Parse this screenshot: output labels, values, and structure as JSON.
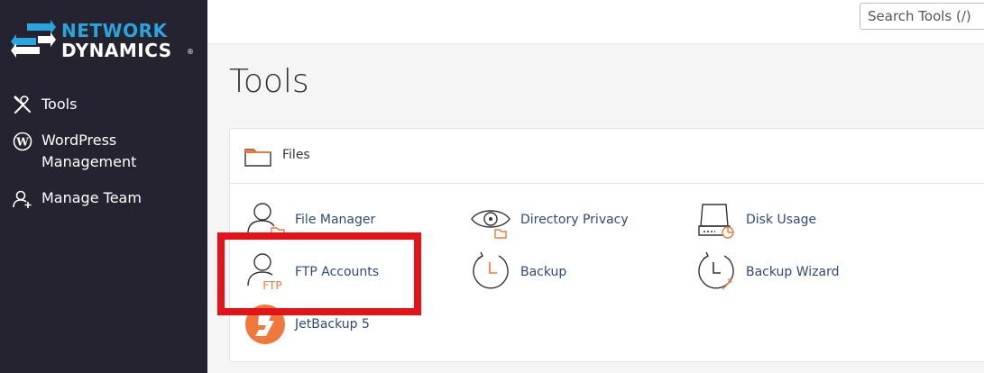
{
  "brand": {
    "line1": "NETWORK",
    "line2": "DYNAMICS",
    "reg": "®"
  },
  "sidebar": {
    "items": [
      {
        "label": "Tools",
        "icon": "tools-icon"
      },
      {
        "label": "WordPress Management",
        "icon": "wordpress-icon"
      },
      {
        "label": "Manage Team",
        "icon": "add-user-icon"
      }
    ]
  },
  "search": {
    "placeholder": "Search Tools (/)"
  },
  "page": {
    "title": "Tools"
  },
  "files": {
    "title": "Files",
    "tools": [
      {
        "label": "File Manager",
        "icon": "file-manager-icon"
      },
      {
        "label": "Directory Privacy",
        "icon": "eye-folder-icon"
      },
      {
        "label": "Disk Usage",
        "icon": "disk-usage-icon"
      },
      {
        "label": "FTP Accounts",
        "icon": "ftp-user-icon"
      },
      {
        "label": "Backup",
        "icon": "backup-clock-icon"
      },
      {
        "label": "Backup Wizard",
        "icon": "backup-wizard-icon"
      },
      {
        "label": "JetBackup 5",
        "icon": "jetbackup-icon"
      }
    ]
  },
  "colors": {
    "sidebar_bg": "#24232f",
    "brand_blue": "#2aa4dc",
    "accent_orange": "#f0783c",
    "link": "#2e4a7a",
    "highlight": "#e3131a"
  }
}
